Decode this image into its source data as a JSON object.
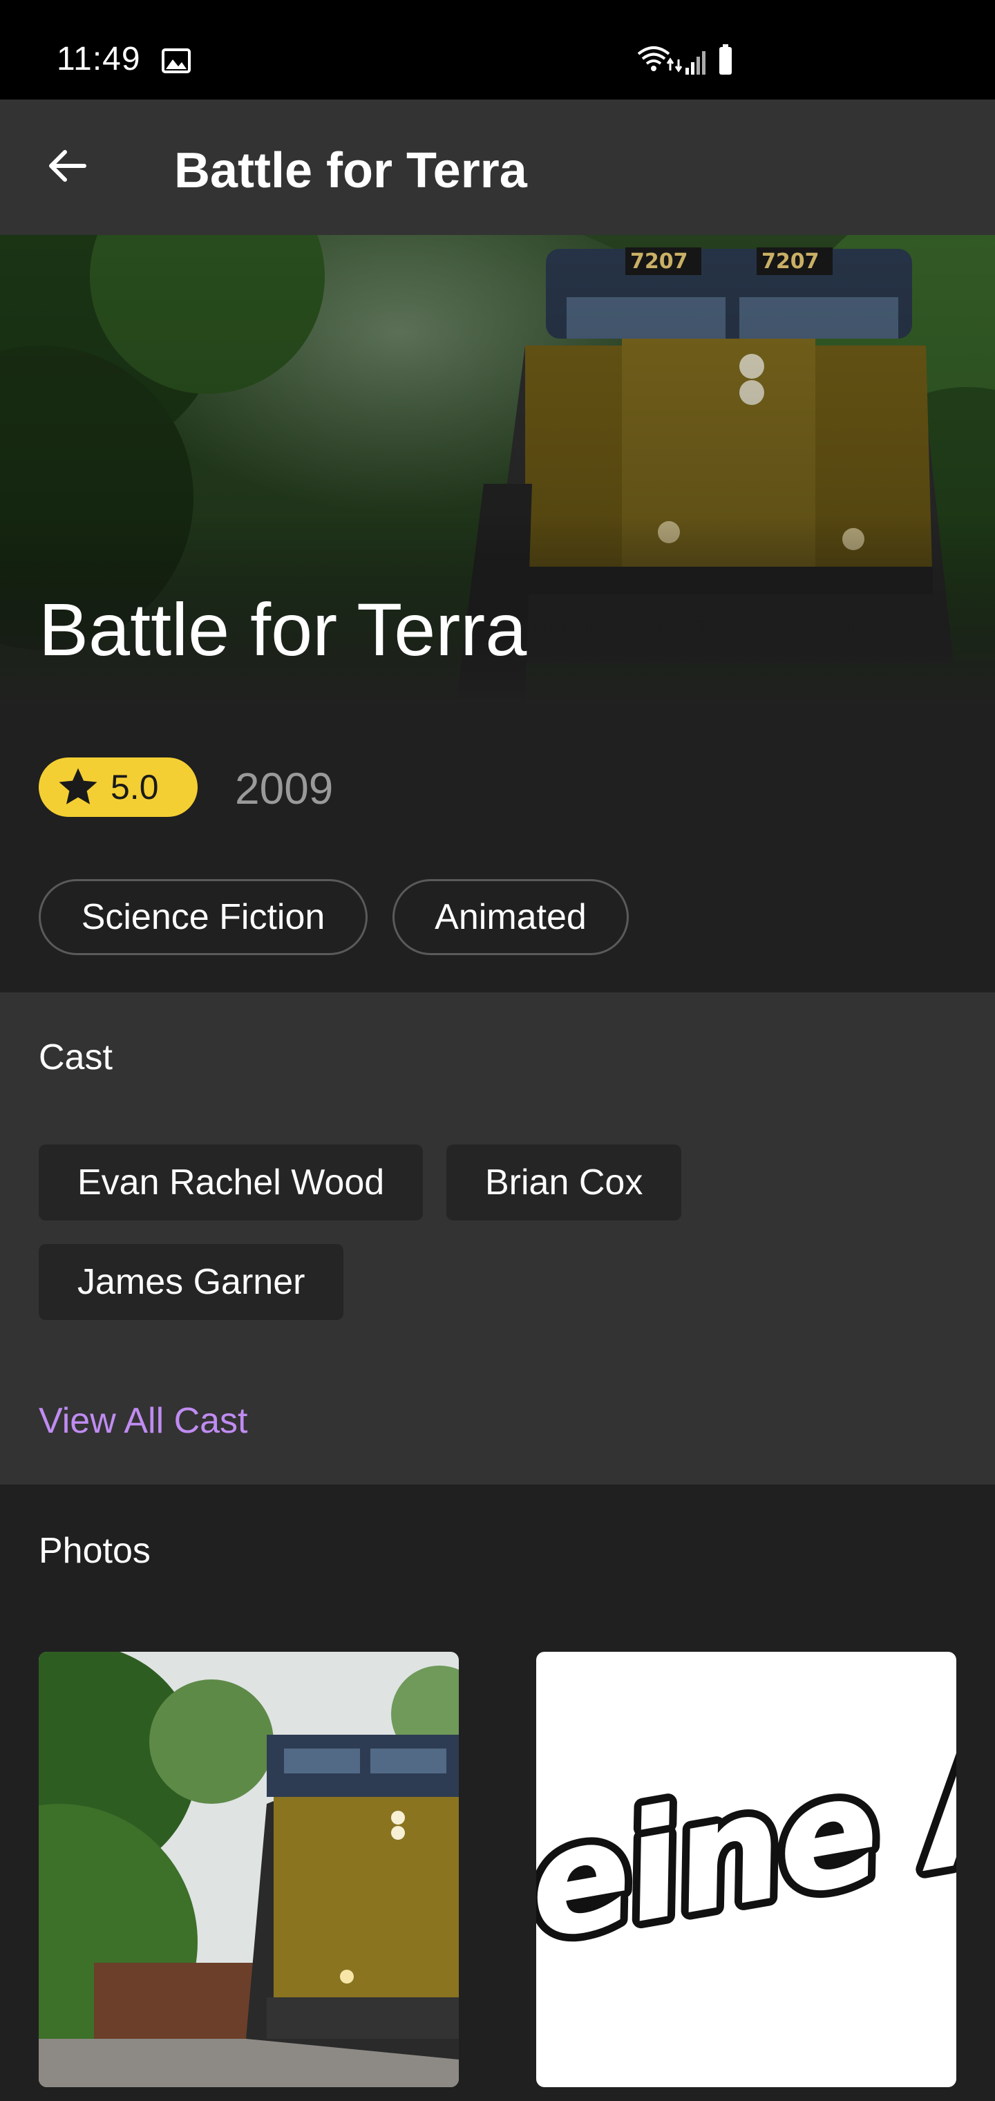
{
  "status_bar": {
    "time": "11:49",
    "icons": [
      "image-icon",
      "wifi-icon",
      "signal-icon",
      "battery-icon"
    ]
  },
  "app_bar": {
    "title": "Battle for Terra",
    "back_icon": "arrow-back-icon"
  },
  "hero": {
    "title": "Battle for Terra",
    "image": "train-locomotive-photo"
  },
  "info": {
    "rating": "5.0",
    "rating_icon": "star-icon",
    "year": "2009",
    "genres": [
      "Science Fiction",
      "Animated"
    ]
  },
  "cast": {
    "title": "Cast",
    "members": [
      "Evan Rachel Wood",
      "Brian Cox",
      "James Garner"
    ],
    "view_all": "View All Cast"
  },
  "photos": {
    "title": "Photos"
  },
  "colors": {
    "status_bar": "#000000",
    "app_bar": "#333333",
    "background": "#202020",
    "rating_badge": "#f4cf33",
    "link": "#c08cf2"
  }
}
